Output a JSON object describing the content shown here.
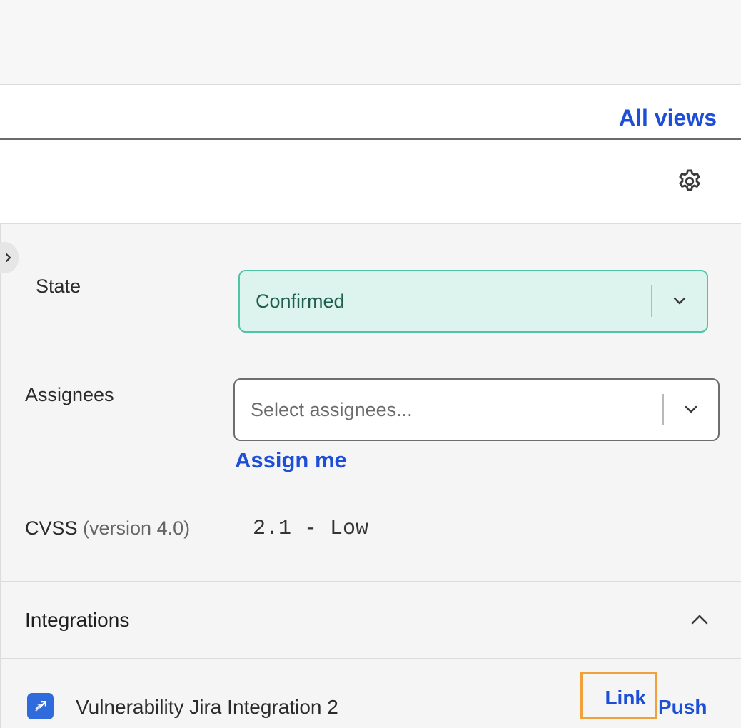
{
  "header": {
    "all_views_label": "All views"
  },
  "toolbar": {
    "settings_icon": "gear-icon"
  },
  "panel": {
    "collapse_icon": "chevron-right-icon",
    "state": {
      "label": "State",
      "value": "Confirmed",
      "colors": {
        "background": "#dcf3ee",
        "border": "#4fc5a6",
        "text": "#1f5e4c"
      }
    },
    "assignees": {
      "label": "Assignees",
      "placeholder": "Select assignees...",
      "assign_me_label": "Assign me"
    },
    "cvss": {
      "label": "CVSS",
      "version_label": "(version 4.0)",
      "value": "2.1 - Low"
    },
    "integrations": {
      "title": "Integrations",
      "expanded": true,
      "items": [
        {
          "name": "Vulnerability Jira Integration 2",
          "icon": "jira-icon",
          "link_label": "Link",
          "push_label": "Push"
        }
      ]
    }
  },
  "colors": {
    "accent": "#1d4ed8",
    "highlight_outline": "#f0a23a"
  }
}
